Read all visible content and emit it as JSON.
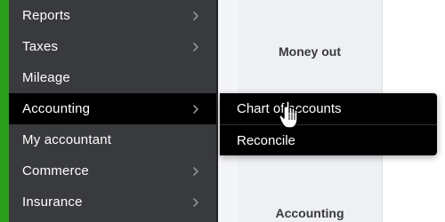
{
  "sidebar": {
    "items": [
      {
        "label": "Reports",
        "has_submenu": true,
        "active": false
      },
      {
        "label": "Taxes",
        "has_submenu": true,
        "active": false
      },
      {
        "label": "Mileage",
        "has_submenu": false,
        "active": false
      },
      {
        "label": "Accounting",
        "has_submenu": true,
        "active": true
      },
      {
        "label": "My accountant",
        "has_submenu": false,
        "active": false
      },
      {
        "label": "Commerce",
        "has_submenu": true,
        "active": false
      },
      {
        "label": "Insurance",
        "has_submenu": true,
        "active": false
      }
    ]
  },
  "flyout": {
    "items": [
      {
        "label": "Chart of accounts",
        "hovered": true
      },
      {
        "label": "Reconcile",
        "hovered": false
      }
    ]
  },
  "main": {
    "money_out_label": "Money out",
    "accounting_label": "Accounting"
  },
  "colors": {
    "sidebar_bg": "#393a3d",
    "active_bg": "#000000",
    "accent_green": "#2ca01c",
    "text_light": "#ffffff",
    "text_dark": "#393a3d"
  },
  "icons": {
    "submenu": "chevron-right-icon",
    "cursor": "hand-pointer-icon"
  }
}
